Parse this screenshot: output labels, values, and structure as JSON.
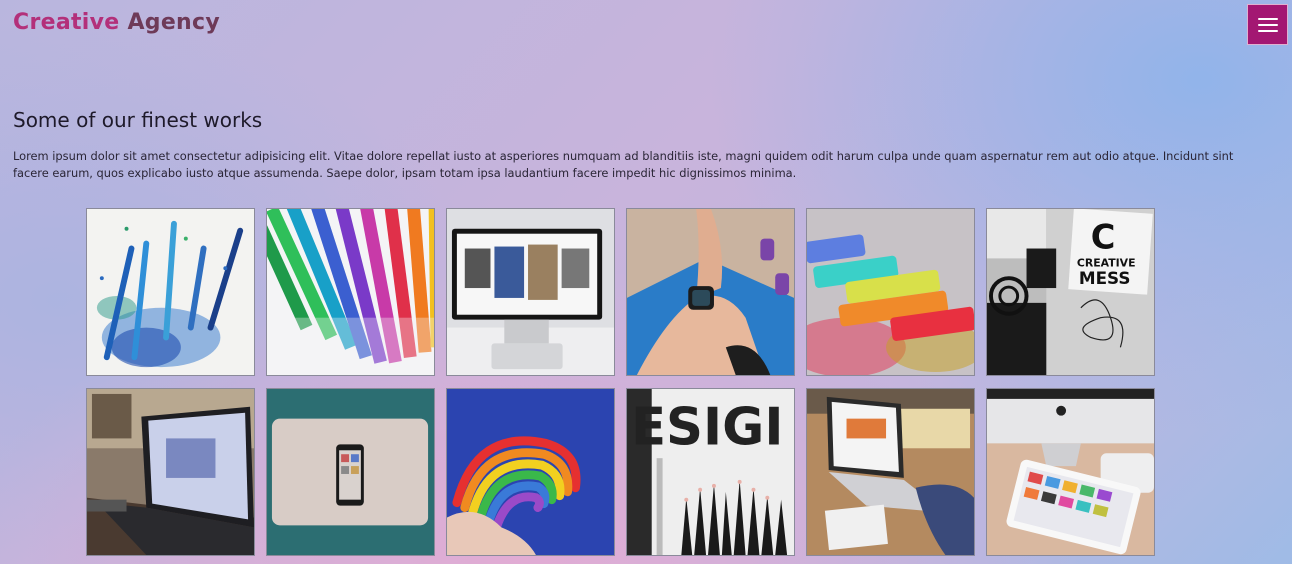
{
  "header": {
    "logo_word1": "Creative",
    "logo_word2": "Agency",
    "menu_icon": "hamburger-icon"
  },
  "colors": {
    "logo_primary": "#b3307a",
    "logo_secondary": "#2f5f52",
    "menu_button": "#a31772"
  },
  "section": {
    "title": "Some of our finest works",
    "description": "Lorem ipsum dolor sit amet consectetur adipisicing elit. Vitae dolore repellat iusto at asperiores numquam ad blanditiis iste, magni quidem odit harum culpa unde quam aspernatur rem aut odio atque. Incidunt sint facere earum, quos explicabo iusto atque assumenda. Saepe dolor, ipsam totam ipsa laudantium facere impedit hic dignissimos minima."
  },
  "gallery": {
    "tiles": [
      {
        "subject": "blue pencils with shavings"
      },
      {
        "subject": "colored pencils"
      },
      {
        "subject": "desktop monitor with gallery"
      },
      {
        "subject": "smartwatch on wrist"
      },
      {
        "subject": "colored chalk pastels"
      },
      {
        "subject": "creative mess collage",
        "text_line1": "C",
        "text_line2": "CREATIVE",
        "text_line3": "MESS"
      },
      {
        "subject": "laptop on desk"
      },
      {
        "subject": "laptop with phone on teal"
      },
      {
        "subject": "rainbow clay in hand"
      },
      {
        "subject": "design pencils",
        "text": "ESIGI"
      },
      {
        "subject": "laptop and notebook on desk"
      },
      {
        "subject": "imac and tablet"
      }
    ]
  }
}
